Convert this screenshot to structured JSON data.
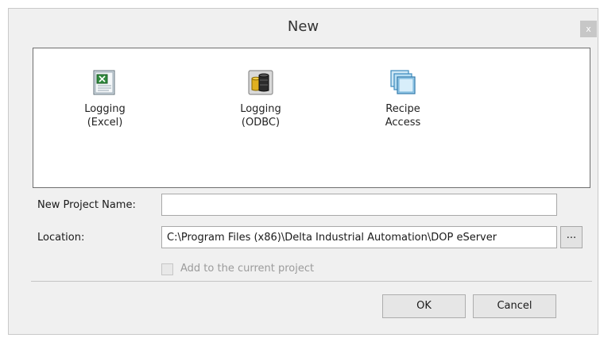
{
  "window": {
    "title": "New",
    "close_label": "x"
  },
  "templates": [
    {
      "label": "Logging\n(Excel)",
      "icon": "excel-log-icon"
    },
    {
      "label": "Logging\n(ODBC)",
      "icon": "database-icon"
    },
    {
      "label": "Recipe\nAccess",
      "icon": "recipe-windows-icon"
    }
  ],
  "form": {
    "project_name_label": "New Project Name:",
    "project_name_value": "",
    "location_label": "Location:",
    "location_value": "C:\\Program Files (x86)\\Delta Industrial Automation\\DOP eServer",
    "browse_label": "...",
    "add_to_current_label": "Add to the current project",
    "add_to_current_checked": false,
    "add_to_current_enabled": false
  },
  "buttons": {
    "ok_label": "OK",
    "cancel_label": "Cancel"
  },
  "colors": {
    "dialog_bg": "#f0f0f0",
    "list_bg": "#ffffff",
    "close_button_bg": "#c7c7c7",
    "disabled_text": "#9b9b9b"
  }
}
